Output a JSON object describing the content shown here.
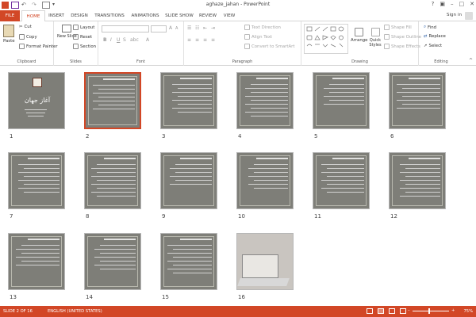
{
  "window": {
    "title": "aghaze_jahan - PowerPoint",
    "signin": "Sign in"
  },
  "tabs": [
    "FILE",
    "HOME",
    "INSERT",
    "DESIGN",
    "TRANSITIONS",
    "ANIMATIONS",
    "SLIDE SHOW",
    "REVIEW",
    "VIEW"
  ],
  "ribbon": {
    "clipboard": {
      "label": "Clipboard",
      "paste": "Paste",
      "cut": "Cut",
      "copy": "Copy",
      "format_painter": "Format Painter"
    },
    "slides": {
      "label": "Slides",
      "new_slide": "New Slide",
      "layout": "Layout",
      "reset": "Reset",
      "section": "Section"
    },
    "font": {
      "label": "Font"
    },
    "paragraph": {
      "label": "Paragraph",
      "text_direction": "Text Direction",
      "align_text": "Align Text",
      "convert": "Convert to SmartArt"
    },
    "drawing": {
      "label": "Drawing",
      "arrange": "Arrange",
      "quick_styles": "Quick Styles",
      "shape_fill": "Shape Fill",
      "shape_outline": "Shape Outline",
      "shape_effects": "Shape Effects"
    },
    "editing": {
      "label": "Editing",
      "find": "Find",
      "replace": "Replace",
      "select": "Select"
    }
  },
  "slides": [
    {
      "num": "1",
      "title": "آغاز جهان"
    },
    {
      "num": "2"
    },
    {
      "num": "3"
    },
    {
      "num": "4"
    },
    {
      "num": "5"
    },
    {
      "num": "6"
    },
    {
      "num": "7"
    },
    {
      "num": "8"
    },
    {
      "num": "9"
    },
    {
      "num": "10"
    },
    {
      "num": "11"
    },
    {
      "num": "12"
    },
    {
      "num": "13"
    },
    {
      "num": "14"
    },
    {
      "num": "15"
    },
    {
      "num": "16"
    }
  ],
  "selected_slide": "2",
  "status": {
    "slide": "SLIDE 2 OF 16",
    "language": "ENGLISH (UNITED STATES)",
    "zoom": "75%"
  },
  "colors": {
    "accent": "#d24726",
    "slide_bg": "#7e7e78"
  }
}
